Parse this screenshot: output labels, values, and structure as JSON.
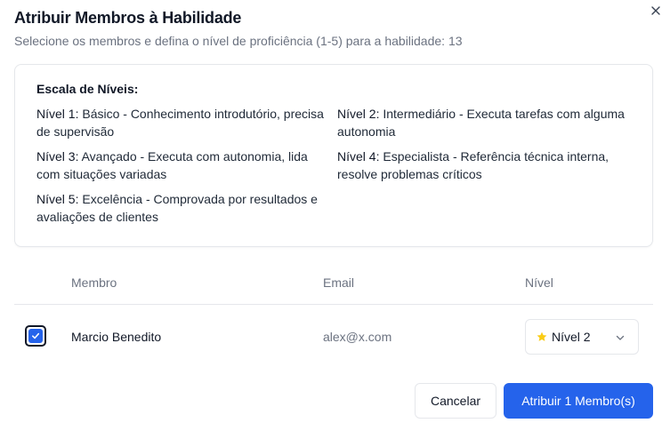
{
  "dialog": {
    "title": "Atribuir Membros à Habilidade",
    "subtitle": "Selecione os membros e defina o nível de proficiência (1-5) para a habilidade: 13",
    "close_icon": "close-icon"
  },
  "scale": {
    "title": "Escala de Níveis:",
    "levels": [
      {
        "name": "Nível 1:",
        "desc": "Básico - Conhecimento introdutório, precisa de supervisão"
      },
      {
        "name": "Nível 2:",
        "desc": "Intermediário - Executa tarefas com alguma autonomia"
      },
      {
        "name": "Nível 3:",
        "desc": "Avançado - Executa com autonomia, lida com situações variadas"
      },
      {
        "name": "Nível 4:",
        "desc": "Especialista - Referência técnica interna, resolve problemas críticos"
      },
      {
        "name": "Nível 5:",
        "desc": "Excelência - Comprovada por resultados e avaliações de clientes"
      }
    ]
  },
  "table": {
    "headers": {
      "member": "Membro",
      "email": "Email",
      "level": "Nível"
    },
    "rows": [
      {
        "checked": true,
        "name": "Marcio Benedito",
        "email": "alex@x.com",
        "level": "Nível 2",
        "level_icon": "star-icon"
      }
    ]
  },
  "actions": {
    "cancel_label": "Cancelar",
    "assign_label": "Atribuir 1 Membro(s)"
  },
  "colors": {
    "accent": "#2563eb",
    "star": "#facc15",
    "muted_text": "#6b7280",
    "border": "#e5e7eb"
  }
}
